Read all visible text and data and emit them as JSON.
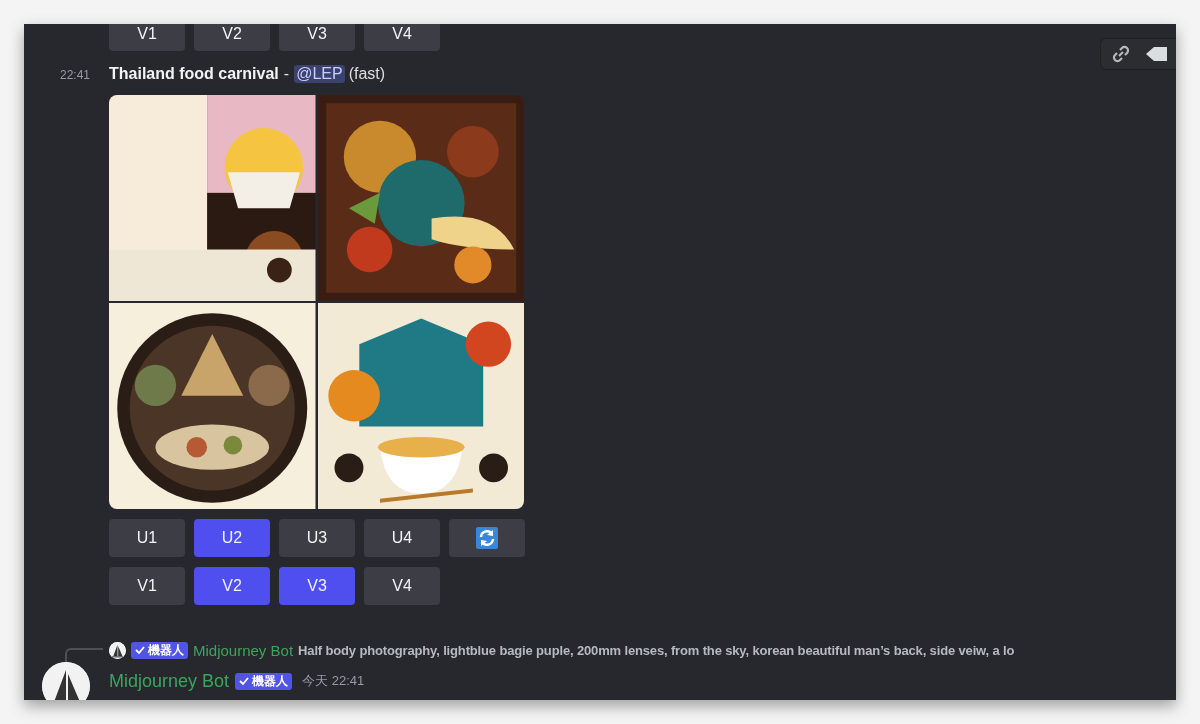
{
  "top_buttons": [
    {
      "label": "V1",
      "selected": false
    },
    {
      "label": "V2",
      "selected": false
    },
    {
      "label": "V3",
      "selected": false
    },
    {
      "label": "V4",
      "selected": false
    }
  ],
  "message": {
    "time": "22:41",
    "prompt": "Thailand food carnival",
    "separator": "-",
    "mention": "@LEP",
    "mode": "(fast)",
    "upscale_buttons": [
      {
        "label": "U1",
        "selected": false
      },
      {
        "label": "U2",
        "selected": true
      },
      {
        "label": "U3",
        "selected": false
      },
      {
        "label": "U4",
        "selected": false
      }
    ],
    "variation_buttons": [
      {
        "label": "V1",
        "selected": false
      },
      {
        "label": "V2",
        "selected": true
      },
      {
        "label": "V3",
        "selected": true
      },
      {
        "label": "V4",
        "selected": false
      }
    ]
  },
  "reply": {
    "badge": "機器人",
    "author": "Midjourney Bot",
    "text": "Half body photography, lightblue bagie puple, 200mm lenses, from the sky, korean beautiful man’s back, side veiw, a lo"
  },
  "next_message": {
    "author": "Midjourney Bot",
    "badge": "機器人",
    "timestamp": "今天 22:41"
  }
}
